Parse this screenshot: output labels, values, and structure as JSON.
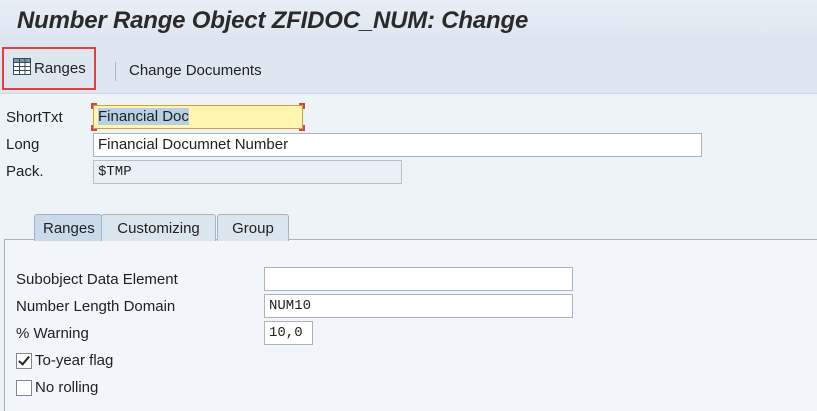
{
  "title": "Number Range Object ZFIDOC_NUM: Change",
  "toolbar": {
    "ranges_label": "Ranges",
    "change_documents_label": "Change Documents"
  },
  "header_fields": {
    "short_text_label": "ShortTxt",
    "short_text_value": "Financial Doc",
    "long_label": "Long",
    "long_value": "Financial Documnet Number",
    "package_label": "Pack.",
    "package_value": "$TMP"
  },
  "tabs": [
    {
      "label": "Ranges",
      "active": true
    },
    {
      "label": "Customizing",
      "active": false
    },
    {
      "label": "Group",
      "active": false
    }
  ],
  "ranges_tab": {
    "subobject_label": "Subobject Data Element",
    "subobject_value": "",
    "number_length_label": "Number Length Domain",
    "number_length_value": "NUM10",
    "warning_label": "% Warning",
    "warning_value": "10,0",
    "to_year_label": "To-year flag",
    "to_year_checked": true,
    "no_rolling_label": "No rolling",
    "no_rolling_checked": false
  },
  "icons": {
    "ranges": "table-grid-icon",
    "checkmark": "check-icon"
  },
  "colors": {
    "highlight_border": "#e04040",
    "focused_field_bg": "#fff5b0",
    "active_tab_bg": "#c9daea"
  }
}
